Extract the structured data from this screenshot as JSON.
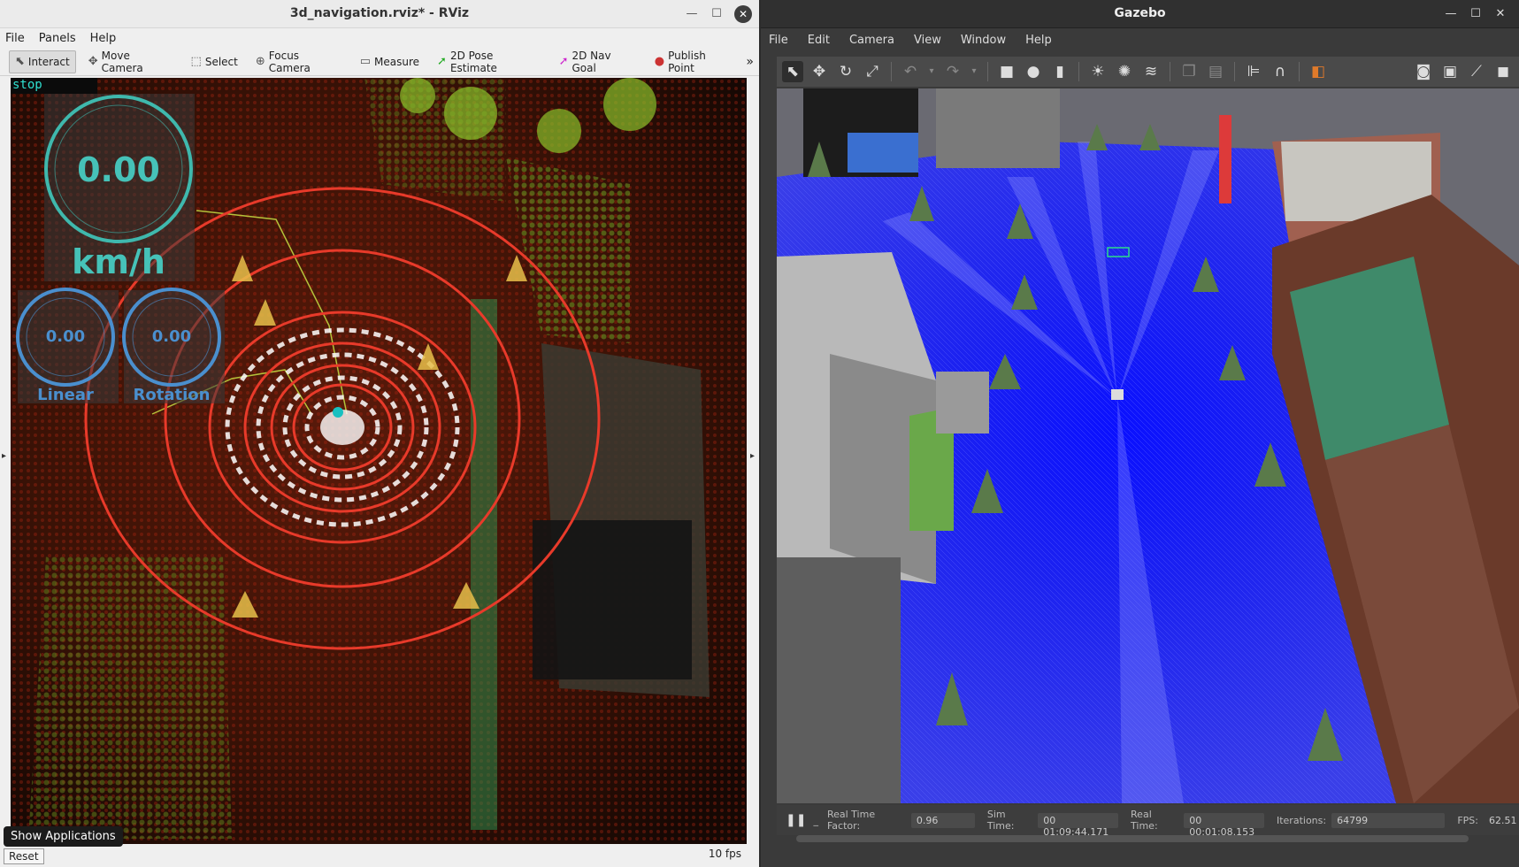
{
  "rviz": {
    "window_title": "3d_navigation.rviz* - RViz",
    "menu": [
      "File",
      "Panels",
      "Help"
    ],
    "tools": [
      {
        "label": "Interact",
        "icon": "cursor-icon",
        "active": true
      },
      {
        "label": "Move Camera",
        "icon": "move-camera-icon"
      },
      {
        "label": "Select",
        "icon": "select-icon"
      },
      {
        "label": "Focus Camera",
        "icon": "focus-camera-icon"
      },
      {
        "label": "Measure",
        "icon": "ruler-icon"
      },
      {
        "label": "2D Pose Estimate",
        "icon": "pose-arrow-icon"
      },
      {
        "label": "2D Nav Goal",
        "icon": "nav-goal-arrow-icon"
      },
      {
        "label": "Publish Point",
        "icon": "map-pin-icon"
      }
    ],
    "overlay": {
      "status": "stop",
      "speed_value": "0.00",
      "speed_unit": "km/h",
      "linear_value": "0.00",
      "linear_label": "Linear",
      "rotation_value": "0.00",
      "rotation_label": "Rotation"
    },
    "status_bar": {
      "reset_label": "Reset",
      "fps": "10 fps"
    },
    "show_applications": "Show Applications"
  },
  "gazebo": {
    "window_title": "Gazebo",
    "menu": [
      "File",
      "Edit",
      "Camera",
      "View",
      "Window",
      "Help"
    ],
    "status": {
      "real_time_factor_label": "Real Time Factor:",
      "real_time_factor": "0.96",
      "sim_time_label": "Sim Time:",
      "sim_time": "00 01:09:44.171",
      "real_time_label": "Real Time:",
      "real_time": "00 00:01:08.153",
      "iterations_label": "Iterations:",
      "iterations": "64799",
      "fps_label": "FPS:",
      "fps": "62.51"
    }
  }
}
